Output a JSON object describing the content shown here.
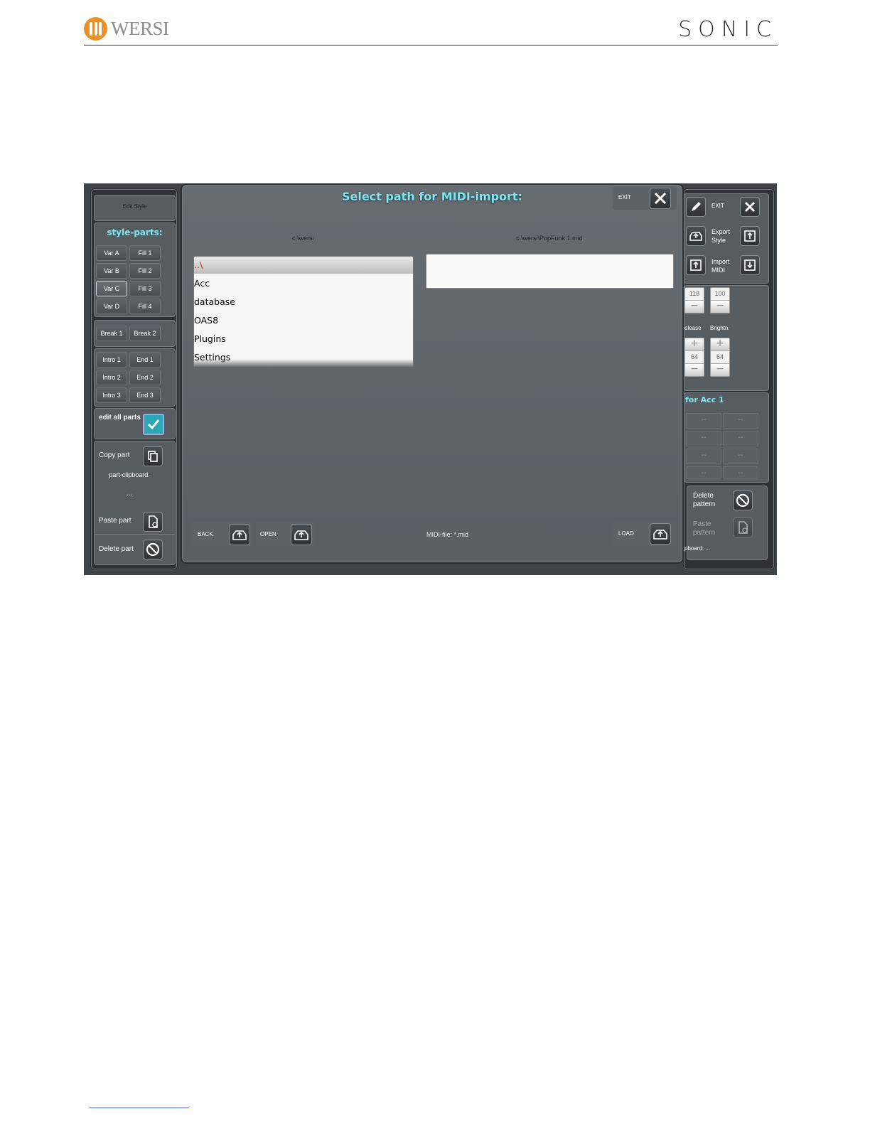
{
  "page_header": {
    "brand_left": "WERSI",
    "brand_right": "SONIC"
  },
  "left_panel": {
    "header": "Edit Style",
    "section_title": "style-parts:",
    "variation_buttons": [
      "Var A",
      "Var B",
      "Var C",
      "Var D"
    ],
    "fill_buttons": [
      "Fill 1",
      "Fill 2",
      "Fill 3",
      "Fill 4"
    ],
    "selected_variation": "Var C",
    "break_buttons": [
      "Break 1",
      "Break 2"
    ],
    "intro_buttons": [
      "Intro 1",
      "Intro 2",
      "Intro 3"
    ],
    "end_buttons": [
      "End 1",
      "End 2",
      "End 3"
    ],
    "edit_all_label": "edit all parts",
    "edit_all_checked": true,
    "copy_part": "Copy part",
    "clipboard_label": "part-clipboard:",
    "clipboard_value": "...",
    "paste_part": "Paste part",
    "delete_part": "Delete part"
  },
  "dialog": {
    "title": "Select path for MIDI-import:",
    "exit_label": "EXIT",
    "current_dir": "c:\\wersi",
    "selected_file_path": "c:\\wersi\\PopFunk 1.mid",
    "directory_list": [
      "..\\",
      "Acc",
      "database",
      "OAS8",
      "Plugins",
      "Settings"
    ],
    "file_filter": "MIDI-file: *.mid",
    "back_label": "BACK",
    "open_label": "OPEN",
    "load_label": "LOAD"
  },
  "right_panel": {
    "exit_label": "EXIT",
    "export_style": "Export Style",
    "import_midi": "Import MIDI",
    "stepper_values": [
      "118",
      "100"
    ],
    "labels": [
      "elease",
      "Brightn."
    ],
    "stepper_values_2": [
      "64",
      "64"
    ],
    "acc_title": "for Acc 1",
    "grid_cells": [
      "--",
      "--",
      "--",
      "--",
      "--",
      "--",
      "--",
      "--"
    ],
    "delete_pattern": "Delete pattern",
    "paste_pattern": "Paste pattern",
    "clipboard": "pboard: ..."
  },
  "colors": {
    "title_cyan": "#7fe7f0",
    "wersi_orange": "#e8922b",
    "check_teal": "#2aa8b3"
  }
}
